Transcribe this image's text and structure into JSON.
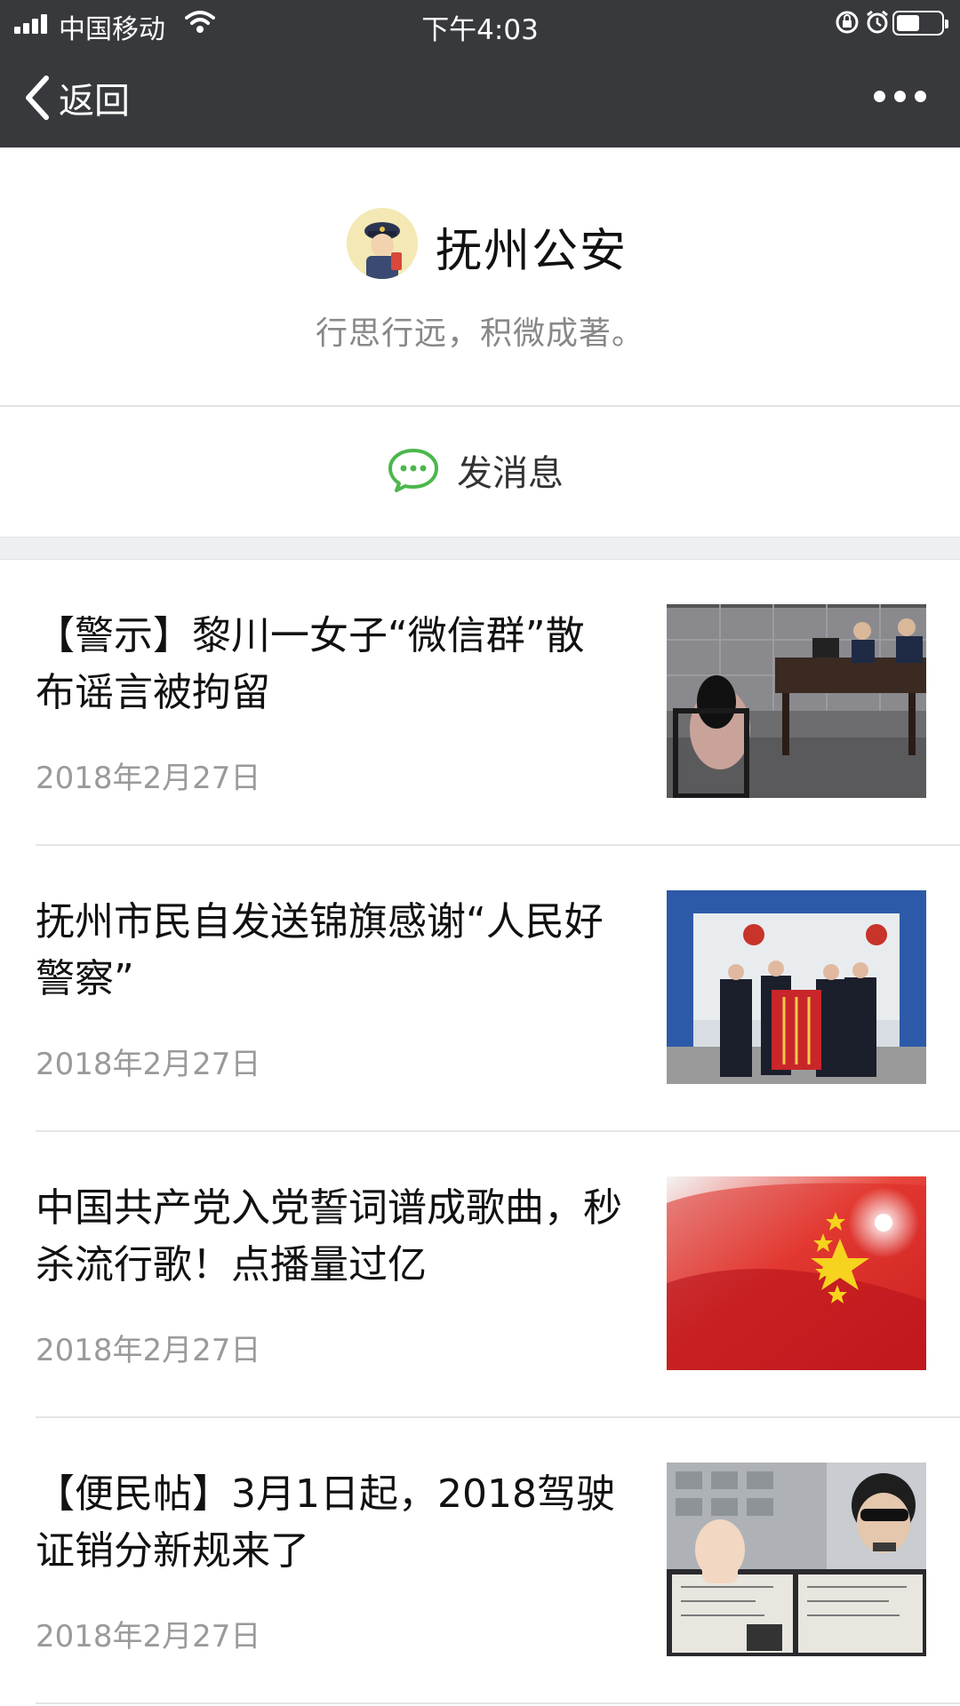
{
  "status_bar": {
    "carrier": "中国移动",
    "time": "下午4:03",
    "battery_level": 0.52
  },
  "nav": {
    "back_label": "返回",
    "more_icon": "more-icon"
  },
  "profile": {
    "name": "抚州公安",
    "motto": "行思行远，积微成著。"
  },
  "message_button": {
    "label": "发消息",
    "icon": "chat-bubble-icon",
    "accent": "#4cb74c"
  },
  "articles": [
    {
      "title": "【警示】黎川一女子“微信群”散布谣言被拘留",
      "date": "2018年2月27日",
      "thumb": "interrogation-photo"
    },
    {
      "title": "抚州市民自发送锦旗感谢“人民好警察”",
      "date": "2018年2月27日",
      "thumb": "banner-ceremony-photo"
    },
    {
      "title": "中国共产党入党誓词谱成歌曲，秒杀流行歌！点播量过亿",
      "date": "2018年2月27日",
      "thumb": "china-flag-photo"
    },
    {
      "title": "【便民帖】3月1日起，2018驾驶证销分新规来了",
      "date": "2018年2月27日",
      "thumb": "license-photo"
    }
  ],
  "colors": {
    "header_bg": "#38393d",
    "divider": "#e5e5e5",
    "date_text": "#9a9a9a"
  }
}
